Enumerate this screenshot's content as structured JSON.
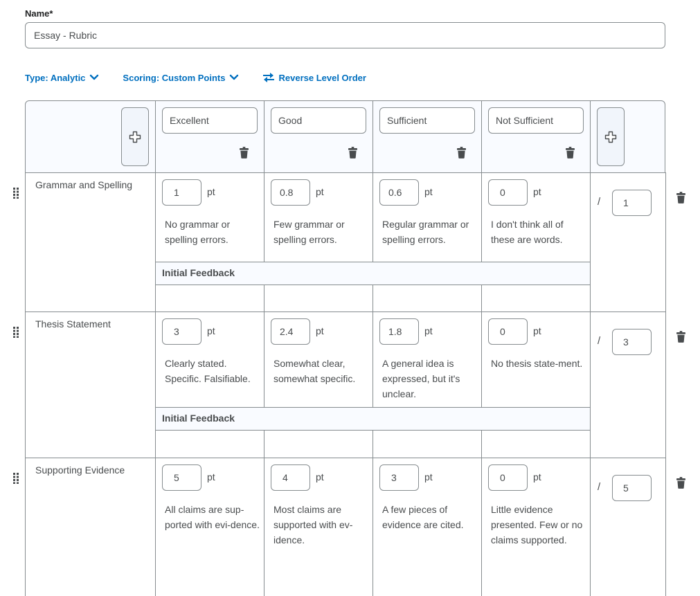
{
  "name_field": {
    "label": "Name*",
    "value": "Essay - Rubric"
  },
  "toolbar": {
    "type_label": "Type: Analytic",
    "scoring_label": "Scoring: Custom Points",
    "reverse_label": "Reverse Level Order"
  },
  "levels": [
    {
      "name": "Excellent"
    },
    {
      "name": "Good"
    },
    {
      "name": "Sufficient"
    },
    {
      "name": "Not Sufficient"
    }
  ],
  "point_unit": "pt",
  "feedback_label": "Initial Feedback",
  "total_separator": "/",
  "criteria": [
    {
      "name": "Grammar and Spelling",
      "total": "1",
      "cells": [
        {
          "points": "1",
          "description": "No grammar or spelling errors."
        },
        {
          "points": "0.8",
          "description": "Few grammar or spelling errors."
        },
        {
          "points": "0.6",
          "description": "Regular grammar or spelling errors."
        },
        {
          "points": "0",
          "description": "I don't think all of these are words."
        }
      ]
    },
    {
      "name": "Thesis Statement",
      "total": "3",
      "cells": [
        {
          "points": "3",
          "description": "Clearly stated. Specific. Falsifiable."
        },
        {
          "points": "2.4",
          "description": "Somewhat clear, somewhat specific."
        },
        {
          "points": "1.8",
          "description": "A general idea is expressed, but it's unclear."
        },
        {
          "points": "0",
          "description": "No thesis state-ment."
        }
      ]
    },
    {
      "name": "Supporting Evidence",
      "total": "5",
      "cells": [
        {
          "points": "5",
          "description": "All claims are sup-ported with evi-dence."
        },
        {
          "points": "4",
          "description": "Most claims are supported with ev-idence."
        },
        {
          "points": "3",
          "description": "A few pieces of evidence are cited."
        },
        {
          "points": "0",
          "description": "Little evidence presented. Few or no claims supported."
        }
      ]
    }
  ]
}
